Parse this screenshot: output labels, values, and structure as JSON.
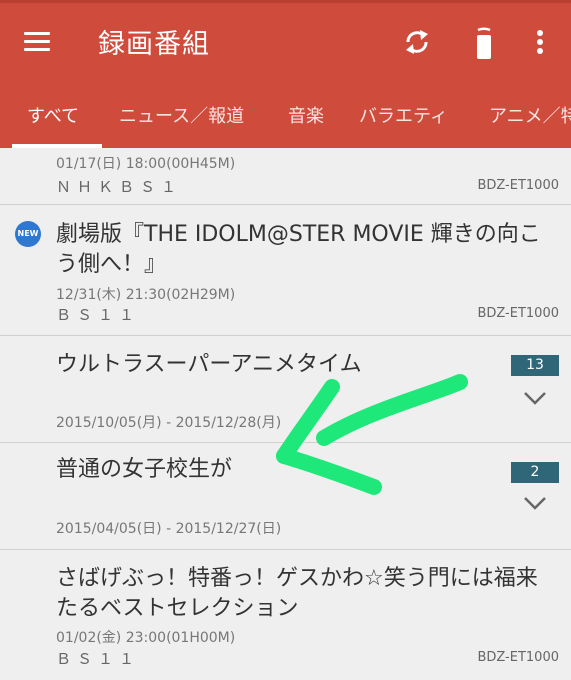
{
  "appbar": {
    "title": "録画番組",
    "icons": [
      "menu-icon",
      "refresh-icon",
      "remote-control-icon",
      "more-vertical-icon"
    ],
    "bg_color": "#cf4b3c"
  },
  "tabs": [
    {
      "label": "すべて",
      "active": true
    },
    {
      "label": "ニュース／報道"
    },
    {
      "label": "音楽"
    },
    {
      "label": "バラエティ"
    },
    {
      "label": "アニメ／特"
    }
  ],
  "recordings": [
    {
      "date": "01/17(日) 18:00(00H45M)",
      "channel": "ＮＨＫＢＳ１",
      "device": "BDZ-ET1000"
    },
    {
      "new_badge": "NEW",
      "title": "劇場版『THE IDOLM@STER MOVIE 輝きの向こう側へ！』",
      "date": "12/31(木) 21:30(02H29M)",
      "channel": "ＢＳ１１",
      "device": "BDZ-ET1000"
    },
    {
      "title": "ウルトラスーパーアニメタイム",
      "date": "2015/10/05(月) - 2015/12/28(月)",
      "count": "13"
    },
    {
      "title": "普通の女子校生が",
      "date": "2015/04/05(日) - 2015/12/27(日)",
      "count": "2"
    },
    {
      "title": "さばげぶっ！特番っ！ゲスかわ☆笑う門には福来たるベストセレクション",
      "date": "01/02(金) 23:00(01H00M)",
      "channel": "ＢＳ１１",
      "device": "BDZ-ET1000"
    }
  ],
  "annotation": {
    "color": "#1ee87a"
  }
}
